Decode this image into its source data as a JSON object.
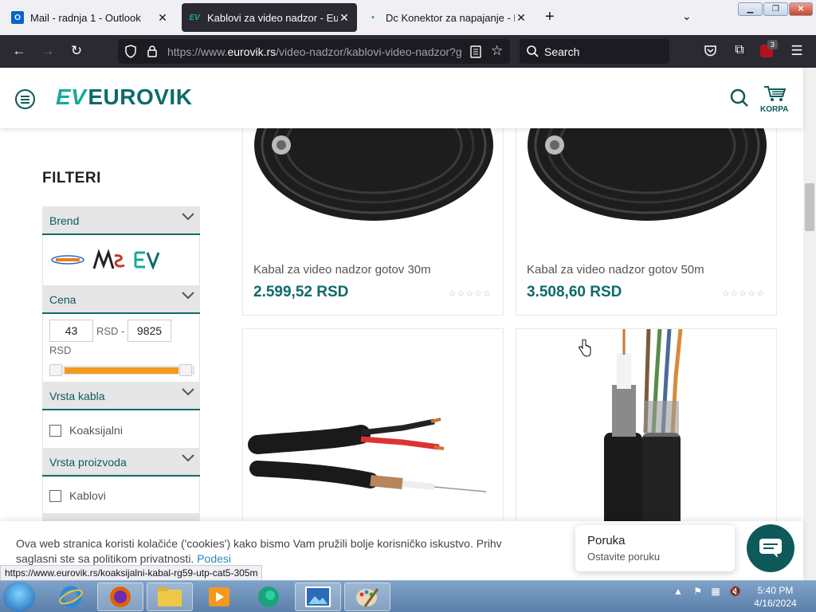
{
  "browser": {
    "tabs": [
      {
        "title": "Mail - radnja 1 - Outlook",
        "favicon": "outlook-icon",
        "active": false
      },
      {
        "title": "Kablovi za video nadzor - Eurov",
        "favicon": "eurovik-icon",
        "active": true
      },
      {
        "title": "Dc Konektor za napajanje - Eurc",
        "favicon": "loading-dot-icon",
        "active": false
      }
    ],
    "url_prefix": "https://www.",
    "url_host": "eurovik.rs",
    "url_path": "/video-nadzor/kablovi-video-nadzor?g",
    "search_placeholder": "Search",
    "extension_badge": "3",
    "status_url": "https://www.eurovik.rs/koaksijalni-kabal-rg59-utp-cat5-305m"
  },
  "site": {
    "logo_mark": "EV",
    "logo_text": "EUROVIK",
    "cart_label": "KORPA",
    "accent_color": "#0e6a6a"
  },
  "filters": {
    "title": "FILTERI",
    "brand": {
      "label": "Brend",
      "logos": [
        "Goodtech logo",
        "WS security western logo",
        "EV logo"
      ]
    },
    "price": {
      "label": "Cena",
      "min": "43",
      "max": "9825",
      "currency": "RSD",
      "separator": "RSD -"
    },
    "cable_type": {
      "label": "Vrsta kabla",
      "options": [
        "Koaksijalni"
      ]
    },
    "product_type": {
      "label": "Vrsta proizvoda",
      "options": [
        "Kablovi"
      ]
    }
  },
  "products": [
    {
      "name": "Kabal za video nadzor gotov 30m",
      "price": "2.599,52 RSD",
      "rating": 0
    },
    {
      "name": "Kabal za video nadzor gotov 50m",
      "price": "3.508,60 RSD",
      "rating": 0
    }
  ],
  "cookie": {
    "line1": "Ova web stranica koristi kolačiće ('cookies') kako bismo Vam pružili bolje korisničko iskustvo. Prihv",
    "line2": "saglasni ste sa politikom privatnosti. ",
    "link": "Podesi"
  },
  "chat": {
    "title": "Poruka",
    "subtitle": "Ostavite poruku"
  },
  "taskbar": {
    "apps": [
      "start-orb-icon",
      "internet-explorer-icon",
      "firefox-icon",
      "file-explorer-icon",
      "media-player-icon",
      "edge-icon",
      "picture-viewer-icon",
      "paint-icon"
    ],
    "time": "5:40 PM",
    "date": "4/16/2024"
  }
}
